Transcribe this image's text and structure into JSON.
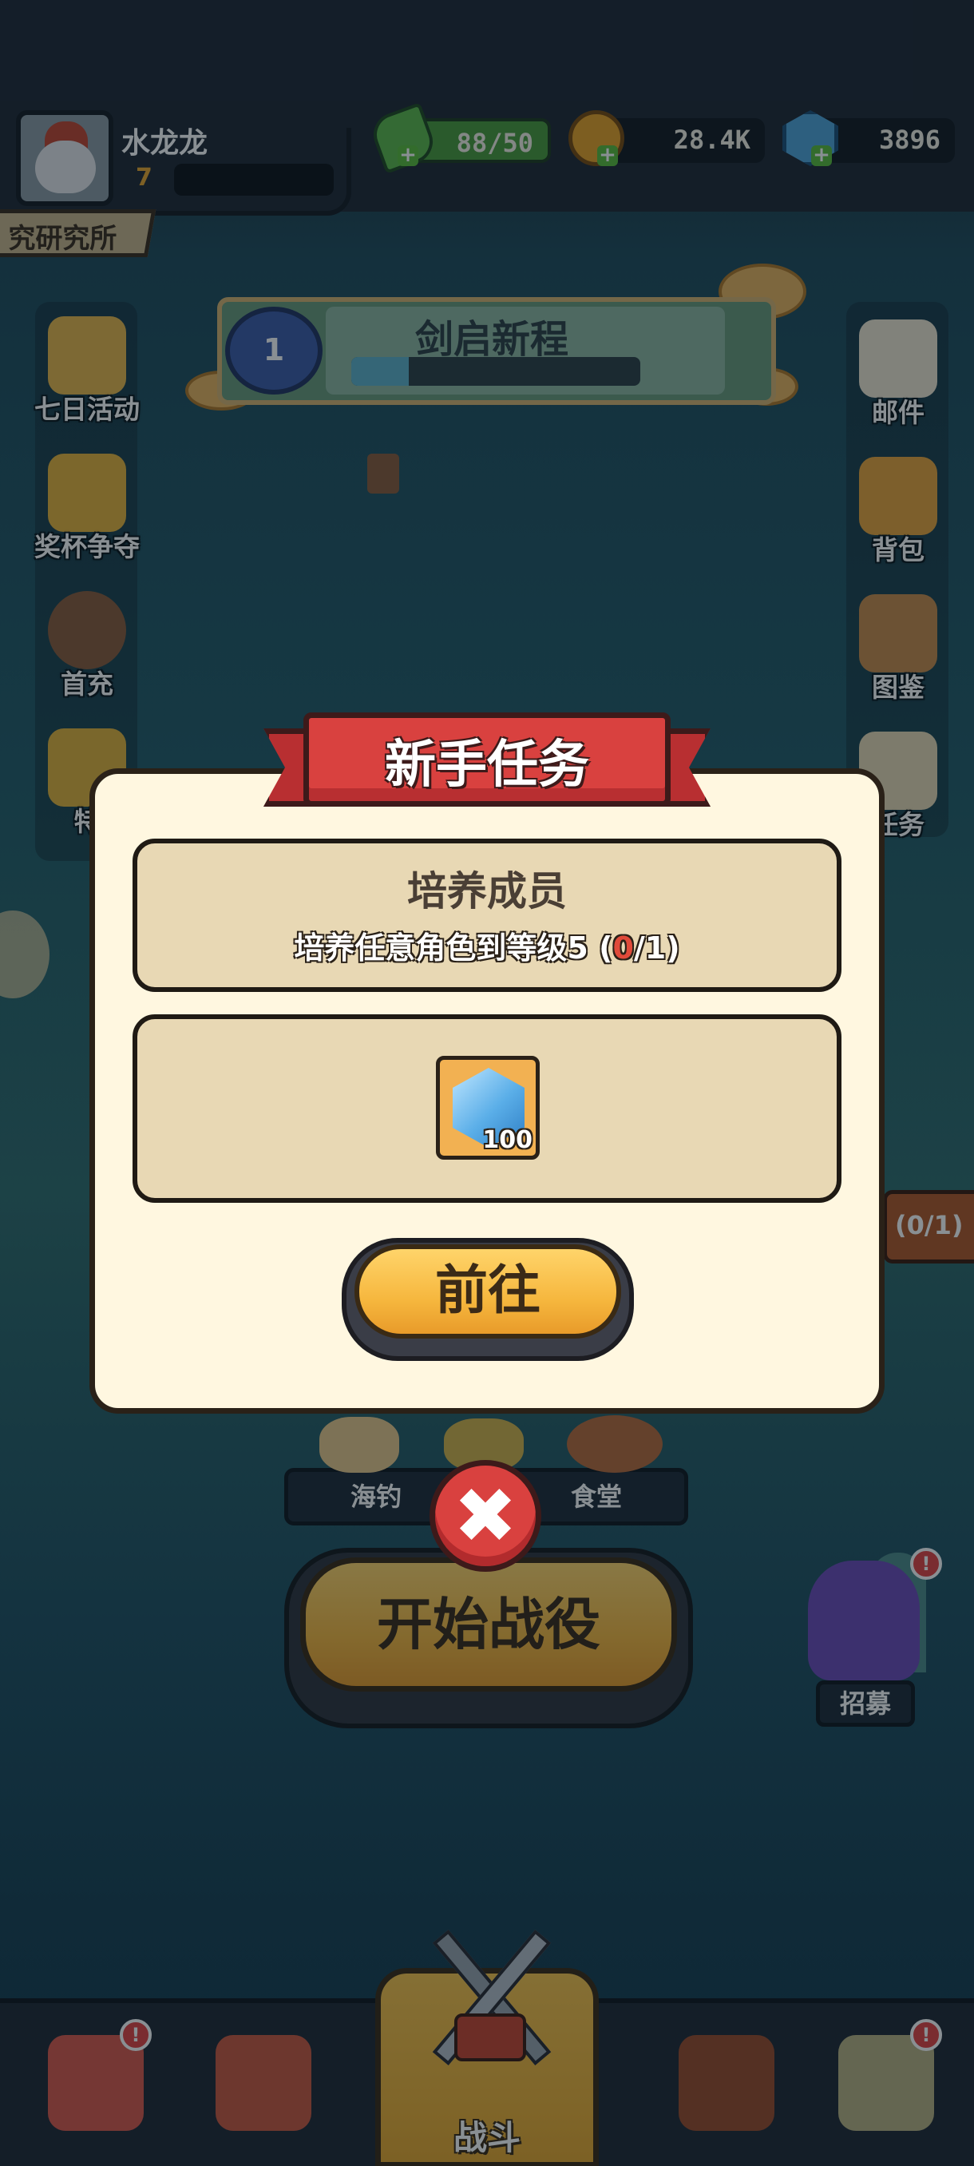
{
  "player": {
    "name": "水龙龙",
    "level": "7"
  },
  "resources": {
    "stamina": {
      "value": "88/50",
      "icon": "stamina-leaf-icon"
    },
    "gold": {
      "value": "28.4K",
      "icon": "gold-coin-icon"
    },
    "gems": {
      "value": "3896",
      "icon": "gem-icon"
    }
  },
  "lab_banner": "究研究所",
  "quest_header": {
    "title": "剑启新程",
    "medal_number": "1",
    "progress": 0.2
  },
  "left_sidebar": [
    {
      "label": "七日活动",
      "icon": "seven-day-icon"
    },
    {
      "label": "奖杯争夺",
      "icon": "trophy-icon"
    },
    {
      "label": "首充",
      "icon": "first-recharge-icon"
    },
    {
      "label": "特",
      "icon": "special-icon"
    }
  ],
  "right_sidebar": [
    {
      "label": "邮件",
      "icon": "mail-icon"
    },
    {
      "label": "背包",
      "icon": "backpack-icon"
    },
    {
      "label": "图鉴",
      "icon": "codex-icon"
    },
    {
      "label": "任务",
      "icon": "task-icon"
    }
  ],
  "dialog": {
    "title": "新手任务",
    "task_title": "培养成员",
    "task_desc_prefix": "培养任意角色到等级5 (",
    "task_current": "0",
    "task_desc_suffix": "/1)",
    "reward": {
      "icon": "gem-reward-icon",
      "quantity": "100"
    },
    "go_button": "前往"
  },
  "right_tab": "(0/1)",
  "facilities": {
    "fishing": "海钓",
    "canteen": "食堂"
  },
  "start_button": "开始战役",
  "recruit": "招募",
  "bottom_nav": {
    "battle": "战斗"
  },
  "colors": {
    "accent_red": "#d9413f",
    "button_gold": "#f6b73e",
    "panel_cream": "#fff7e0"
  }
}
